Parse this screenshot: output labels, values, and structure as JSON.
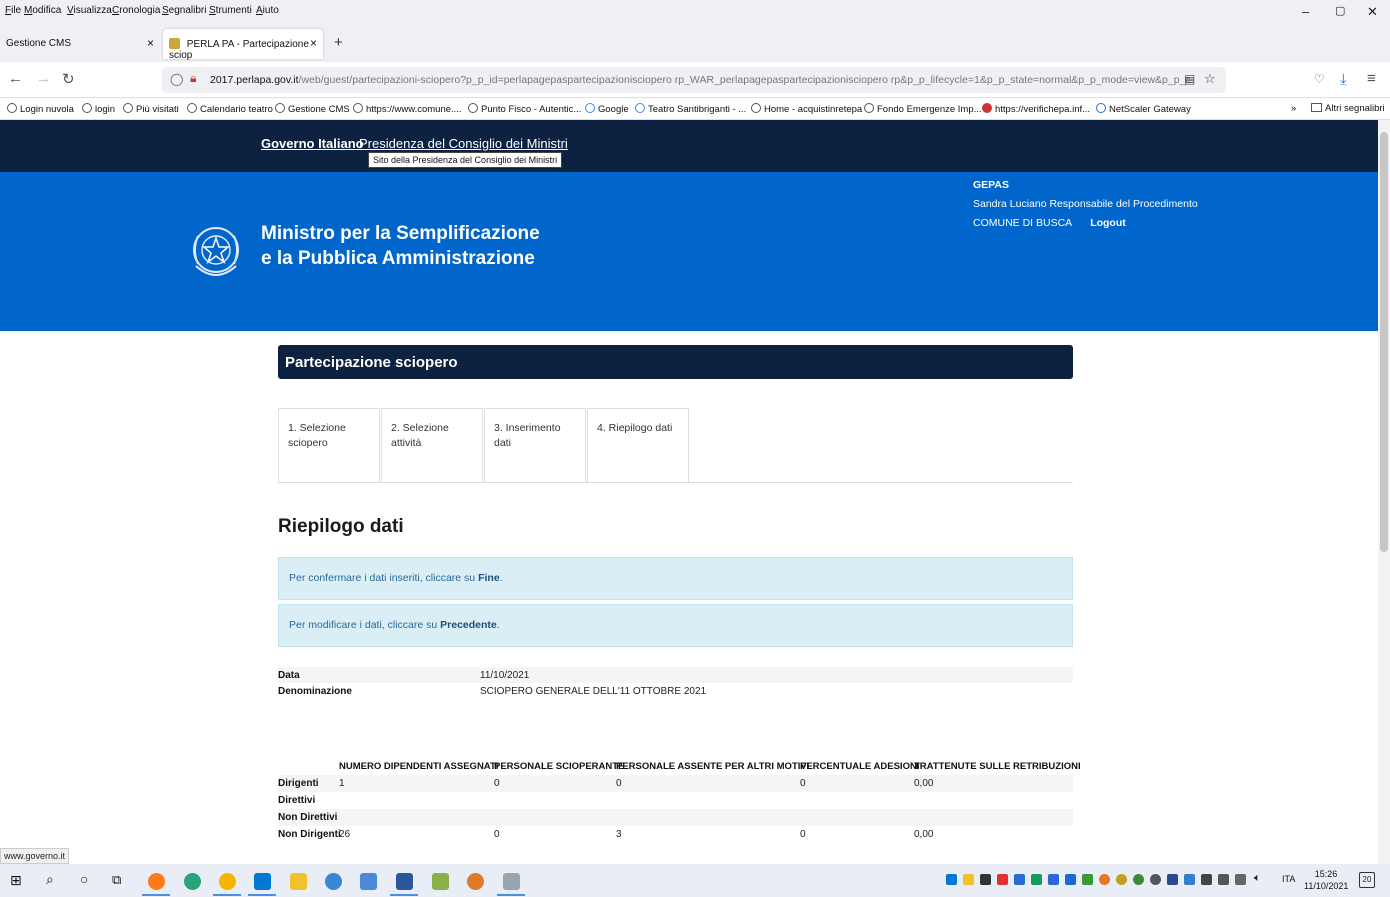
{
  "browser": {
    "menu": [
      "File",
      "Modifica",
      "Visualizza",
      "Cronologia",
      "Segnalibri",
      "Strumenti",
      "Aiuto"
    ],
    "tabs": [
      {
        "label": "Gestione CMS",
        "active": false
      },
      {
        "label": "PERLA PA - Partecipazione sciop",
        "active": true
      }
    ],
    "new_tab": "+",
    "url_host": "2017.perlapa.gov.it",
    "url_rest": "/web/guest/partecipazioni-sciopero?p_p_id=perlapagepaspartecipazionisciopero rp_WAR_perlapagepaspartecipazionisciopero rp&p_p_lifecycle=1&p_p_state=normal&p_p_mode=view&p_p_col_id=colu",
    "bookmarks": [
      "Login nuvola",
      "login",
      "Più visitati",
      "Calendario teatro",
      "Gestione CMS",
      "https://www.comune....",
      "Punto Fisco - Autentic...",
      "Google",
      "Teatro Santibriganti - ...",
      "Home - acquistinretepa",
      "Fondo Emergenze Imp...",
      "https://verifichepa.inf...",
      "NetScaler Gateway"
    ],
    "other_bookmarks": "Altri segnalibri",
    "status_link": "www.governo.it"
  },
  "gov": {
    "governo": "Governo Italiano",
    "presidenza": "Presidenza del Consiglio dei Ministri",
    "tooltip": "Sito della Presidenza del Consiglio dei Ministri"
  },
  "hero": {
    "line1": "Ministro per la Semplificazione",
    "line2": "e la Pubblica Amministrazione",
    "system": "GEPAS",
    "user": "Sandra Luciano Responsabile del Procedimento",
    "ente": "COMUNE DI BUSCA",
    "logout": "Logout"
  },
  "page": {
    "title": "Partecipazione sciopero",
    "steps": [
      "1. Selezione sciopero",
      "2. Selezione attività",
      "3. Inserimento dati",
      "4. Riepilogo dati"
    ],
    "section": "Riepilogo dati",
    "alert1_text": "Per confermare i dati inseriti, cliccare su ",
    "alert1_bold": "Fine",
    "alert2_text": "Per modificare i dati, cliccare su ",
    "alert2_bold": "Precedente",
    "summary": [
      {
        "key": "Data",
        "value": "11/10/2021"
      },
      {
        "key": "Denominazione",
        "value": "SCIOPERO GENERALE DELL'11 OTTOBRE 2021"
      }
    ],
    "columns": [
      "NUMERO DIPENDENTI ASSEGNATI",
      "PERSONALE SCIOPERANTE",
      "PERSONALE ASSENTE PER ALTRI MOTIVI",
      "PERCENTUALE ADESIONI",
      "TRATTENUTE SULLE RETRIBUZIONI"
    ],
    "rows": [
      {
        "label": "Dirigenti",
        "cells": [
          "1",
          "0",
          "0",
          "0",
          "0,00"
        ]
      },
      {
        "label": "Direttivi",
        "cells": [
          "",
          "",
          "",
          "",
          ""
        ]
      },
      {
        "label": "Non Direttivi",
        "cells": [
          "",
          "",
          "",
          "",
          ""
        ]
      },
      {
        "label": "Non Dirigenti",
        "cells": [
          "26",
          "0",
          "3",
          "0",
          "0,00"
        ]
      }
    ]
  },
  "taskbar": {
    "lang": "ITA",
    "time": "15:26",
    "date": "11/10/2021",
    "notifications": "20"
  },
  "colors": {
    "gov_bar": "#0d2240",
    "hero": "#0066cc",
    "alert_bg": "#d9eef5"
  }
}
